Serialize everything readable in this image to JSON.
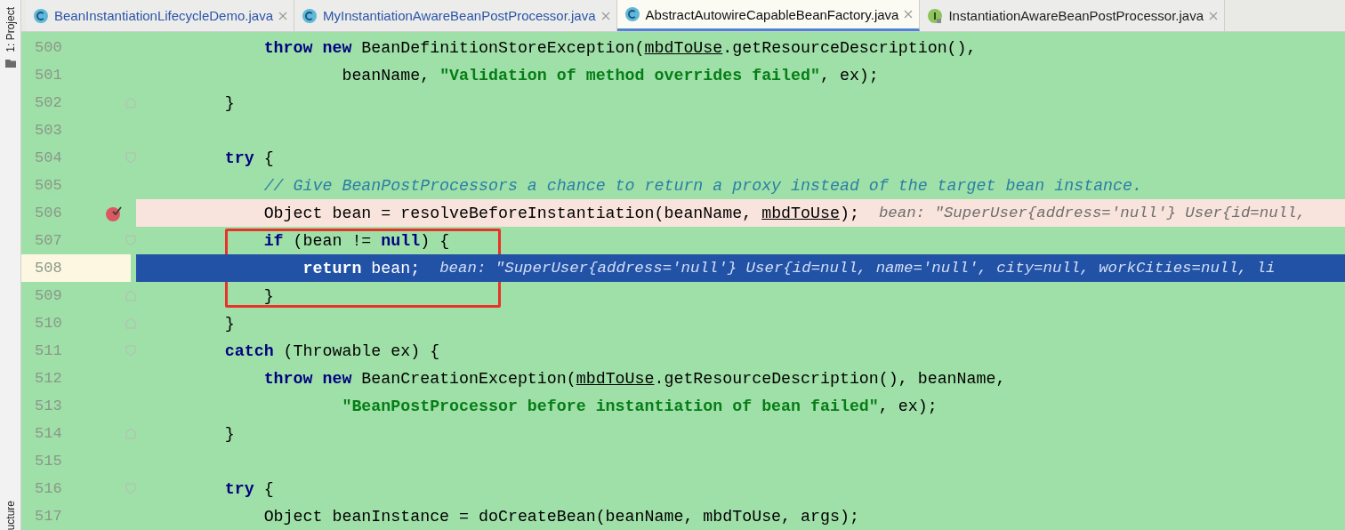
{
  "sidebar": {
    "top_tool": "1: Project",
    "bottom_tool": "ucture"
  },
  "tabs": [
    {
      "label": "BeanInstantiationLifecycleDemo.java",
      "kind": "class",
      "color": "#2d55a8",
      "selected": false
    },
    {
      "label": "MyInstantiationAwareBeanPostProcessor.java",
      "kind": "class",
      "color": "#2d55a8",
      "selected": false
    },
    {
      "label": "AbstractAutowireCapableBeanFactory.java",
      "kind": "class",
      "color": "#111111",
      "selected": true
    },
    {
      "label": "InstantiationAwareBeanPostProcessor.java",
      "kind": "interface",
      "color": "#222222",
      "selected": false
    }
  ],
  "editor": {
    "lines": [
      {
        "number": "500",
        "breakpoint": false,
        "current": false,
        "boxed": false,
        "fold_open": false,
        "fold_close": false,
        "tokens": [
          {
            "kind": "keyword",
            "text": "            throw new"
          },
          {
            "kind": "plain",
            "text": " BeanDefinitionStoreException("
          },
          {
            "kind": "underlined",
            "text": "mbdToUse"
          },
          {
            "kind": "plain",
            "text": ".getResourceDescription(),"
          }
        ]
      },
      {
        "number": "501",
        "breakpoint": false,
        "current": false,
        "boxed": false,
        "fold_open": false,
        "fold_close": false,
        "tokens": [
          {
            "kind": "plain",
            "text": "                    beanName, "
          },
          {
            "kind": "string",
            "text": "\"Validation of method overrides failed\""
          },
          {
            "kind": "plain",
            "text": ", ex);"
          }
        ]
      },
      {
        "number": "502",
        "breakpoint": false,
        "current": false,
        "boxed": false,
        "fold_open": false,
        "fold_close": true,
        "tokens": [
          {
            "kind": "plain",
            "text": "        }"
          }
        ]
      },
      {
        "number": "503",
        "breakpoint": false,
        "current": false,
        "boxed": false,
        "fold_open": false,
        "fold_close": false
      },
      {
        "number": "504",
        "breakpoint": false,
        "current": false,
        "boxed": false,
        "fold_open": true,
        "fold_close": false,
        "tokens": [
          {
            "kind": "keyword",
            "text": "        try"
          },
          {
            "kind": "plain",
            "text": " {"
          }
        ]
      },
      {
        "number": "505",
        "breakpoint": false,
        "current": false,
        "boxed": false,
        "fold_open": false,
        "fold_close": false,
        "tokens": [
          {
            "kind": "comment",
            "text": "            // Give BeanPostProcessors a chance to return a proxy instead of the target bean instance."
          }
        ]
      },
      {
        "number": "506",
        "breakpoint": true,
        "current": false,
        "boxed": false,
        "fold_open": false,
        "fold_close": false,
        "tokens": [
          {
            "kind": "plain",
            "text": "            Object bean = resolveBeforeInstantiation(beanName, "
          },
          {
            "kind": "underlined",
            "text": "mbdToUse"
          },
          {
            "kind": "plain",
            "text": ");"
          }
        ],
        "hint": "bean: \"SuperUser{address='null'} User{id=null,"
      },
      {
        "number": "507",
        "breakpoint": false,
        "current": false,
        "boxed": true,
        "fold_open": true,
        "fold_close": false,
        "tokens": [
          {
            "kind": "keyword",
            "text": "            if"
          },
          {
            "kind": "plain",
            "text": " (bean != "
          },
          {
            "kind": "keyword",
            "text": "null"
          },
          {
            "kind": "plain",
            "text": ") {"
          }
        ]
      },
      {
        "number": "508",
        "breakpoint": false,
        "current": true,
        "boxed": true,
        "fold_open": false,
        "fold_close": false,
        "tokens": [
          {
            "kind": "keyword",
            "text": "                return"
          },
          {
            "kind": "plain",
            "text": " bean;"
          }
        ],
        "hint": "bean: \"SuperUser{address='null'} User{id=null, name='null', city=null, workCities=null, li"
      },
      {
        "number": "509",
        "breakpoint": false,
        "current": false,
        "boxed": true,
        "fold_open": false,
        "fold_close": true,
        "tokens": [
          {
            "kind": "plain",
            "text": "            }"
          }
        ]
      },
      {
        "number": "510",
        "breakpoint": false,
        "current": false,
        "boxed": false,
        "fold_open": false,
        "fold_close": true,
        "tokens": [
          {
            "kind": "plain",
            "text": "        }"
          }
        ]
      },
      {
        "number": "511",
        "breakpoint": false,
        "current": false,
        "boxed": false,
        "fold_open": true,
        "fold_close": false,
        "tokens": [
          {
            "kind": "keyword",
            "text": "        catch"
          },
          {
            "kind": "plain",
            "text": " (Throwable ex) {"
          }
        ]
      },
      {
        "number": "512",
        "breakpoint": false,
        "current": false,
        "boxed": false,
        "fold_open": false,
        "fold_close": false,
        "tokens": [
          {
            "kind": "keyword",
            "text": "            throw new"
          },
          {
            "kind": "plain",
            "text": " BeanCreationException("
          },
          {
            "kind": "underlined",
            "text": "mbdToUse"
          },
          {
            "kind": "plain",
            "text": ".getResourceDescription(), beanName,"
          }
        ]
      },
      {
        "number": "513",
        "breakpoint": false,
        "current": false,
        "boxed": false,
        "fold_open": false,
        "fold_close": false,
        "tokens": [
          {
            "kind": "string",
            "text": "                    \"BeanPostProcessor before instantiation of bean failed\""
          },
          {
            "kind": "plain",
            "text": ", ex);"
          }
        ]
      },
      {
        "number": "514",
        "breakpoint": false,
        "current": false,
        "boxed": false,
        "fold_open": false,
        "fold_close": true,
        "tokens": [
          {
            "kind": "plain",
            "text": "        }"
          }
        ]
      },
      {
        "number": "515",
        "breakpoint": false,
        "current": false,
        "boxed": false,
        "fold_open": false,
        "fold_close": false
      },
      {
        "number": "516",
        "breakpoint": false,
        "current": false,
        "boxed": false,
        "fold_open": true,
        "fold_close": false,
        "tokens": [
          {
            "kind": "keyword",
            "text": "        try"
          },
          {
            "kind": "plain",
            "text": " {"
          }
        ]
      },
      {
        "number": "517",
        "breakpoint": false,
        "current": false,
        "boxed": false,
        "fold_open": false,
        "fold_close": false,
        "tokens": [
          {
            "kind": "plain",
            "text": "            Object beanInstance = doCreateBean(beanName, mbdToUse, args);"
          }
        ]
      }
    ]
  }
}
